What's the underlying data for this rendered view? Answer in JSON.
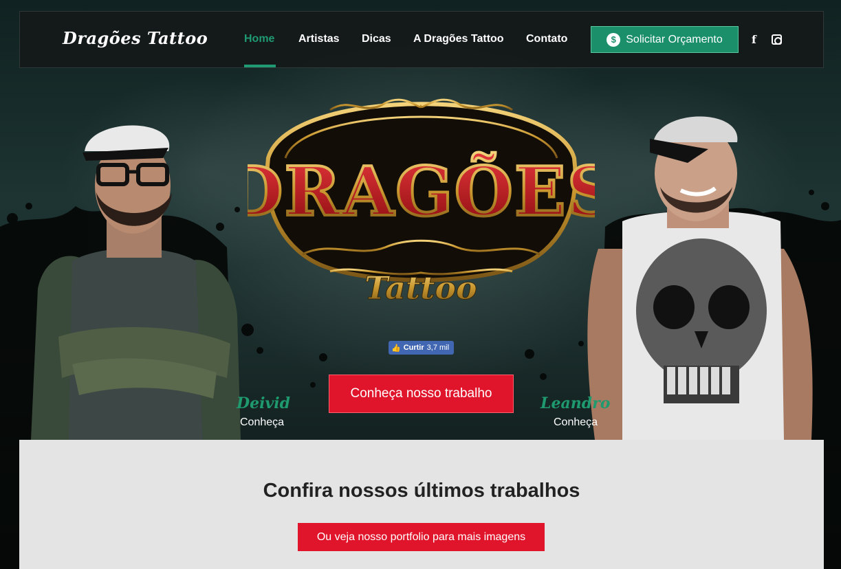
{
  "colors": {
    "accent_green": "#1f9a73",
    "cta_red": "#e0142a",
    "facebook_blue": "#4267b2",
    "logo_gold": "#c8962e",
    "logo_red": "#b3171a"
  },
  "navbar": {
    "brand": "Dragões Tattoo",
    "items": [
      {
        "label": "Home",
        "active": true
      },
      {
        "label": "Artistas"
      },
      {
        "label": "Dicas"
      },
      {
        "label": "A Dragões Tattoo"
      },
      {
        "label": "Contato"
      }
    ],
    "quote_button": {
      "label": "Solicitar Orçamento",
      "icon": "money-bag-icon"
    },
    "social": [
      {
        "icon": "facebook-icon",
        "glyph": "f"
      },
      {
        "icon": "instagram-icon"
      }
    ]
  },
  "hero": {
    "logo": {
      "title": "DRAGÕES",
      "subtitle": "Tattoo"
    },
    "like_button": {
      "label": "Curtir",
      "count": "3,7 mil",
      "icon": "thumbs-up-icon"
    },
    "cta_label": "Conheça nosso trabalho",
    "artists": [
      {
        "name": "Deivid",
        "link": "Conheça"
      },
      {
        "name": "Leandro",
        "link": "Conheça"
      }
    ]
  },
  "portfolio": {
    "title": "Confira nossos últimos trabalhos",
    "button_label": "Ou veja nosso portfolio para mais imagens"
  }
}
